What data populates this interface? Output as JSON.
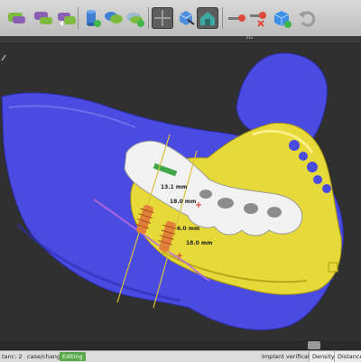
{
  "toolbar": {
    "items": [
      {
        "icon": "stl-import-icon"
      },
      {
        "icon": "stl-bite-icon"
      },
      {
        "icon": "stl-export-icon"
      },
      {
        "icon": "cylinder-icon"
      },
      {
        "icon": "cylinder-plus-icon"
      },
      {
        "icon": "green-blocks-icon"
      },
      {
        "icon": "blocks-plus-icon"
      },
      {
        "icon": "crosshair-icon"
      },
      {
        "icon": "cube-view-icon"
      },
      {
        "icon": "house-view-icon"
      },
      {
        "icon": "key-icon"
      },
      {
        "icon": "key-remove-icon"
      },
      {
        "icon": "blue-cube-icon"
      },
      {
        "icon": "undo-icon"
      }
    ]
  },
  "subbar": {
    "label": "3D"
  },
  "viewport": {
    "measurements": [
      "13.1 mm",
      "18.0 mm",
      "6.0 mm",
      "18.0 mm"
    ],
    "colors": {
      "bone": "#4a4be0",
      "model": "#e7d93a",
      "guide": "#f2f2f2",
      "implant": "#e0803a",
      "nerve": "#b86bd8",
      "axis": "#d9c23a"
    }
  },
  "statusbar": {
    "prefix": "tanc: 2",
    "case_label": "case/change:",
    "status_badge": "Editing",
    "implant_verification": "Implant verification:",
    "density_button": "Density",
    "distance_button": "Distance fo"
  }
}
